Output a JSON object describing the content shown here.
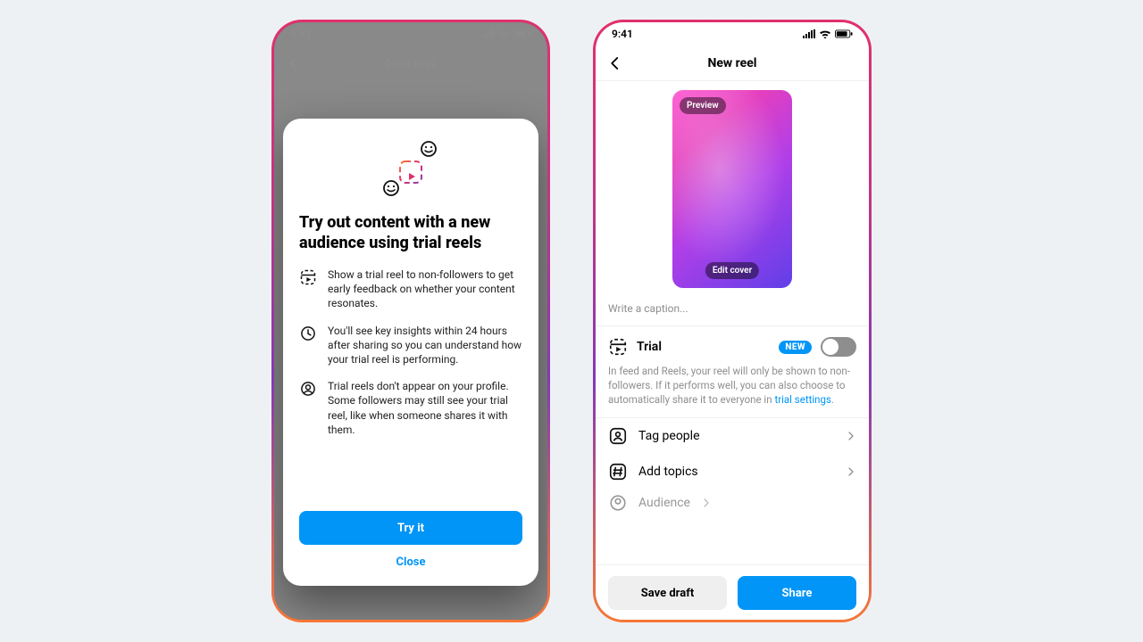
{
  "leftPhone": {
    "time": "9:41",
    "navTitle": "New reel",
    "modal": {
      "title": "Try out content with a new audience using trial reels",
      "bullets": [
        "Show a trial reel to non-followers to get early feedback on whether your content resonates.",
        "You'll see key insights within 24 hours after sharing so you can understand how your trial reel is performing.",
        "Trial reels don't appear on your profile. Some followers may still see your trial reel, like when someone shares it with them."
      ],
      "primary": "Try it",
      "secondary": "Close"
    }
  },
  "rightPhone": {
    "time": "9:41",
    "navTitle": "New reel",
    "cover": {
      "preview": "Preview",
      "edit": "Edit cover"
    },
    "captionPlaceholder": "Write a caption...",
    "trial": {
      "label": "Trial",
      "badge": "NEW",
      "desc": "In feed and Reels, your reel will only be shown to non-followers. If it performs well, you can also choose to automatically share it to everyone in ",
      "link": "trial settings",
      "punct": "."
    },
    "rows": {
      "tagPeople": "Tag people",
      "addTopics": "Add topics",
      "audience": "Audience"
    },
    "buttons": {
      "draft": "Save draft",
      "share": "Share"
    }
  }
}
